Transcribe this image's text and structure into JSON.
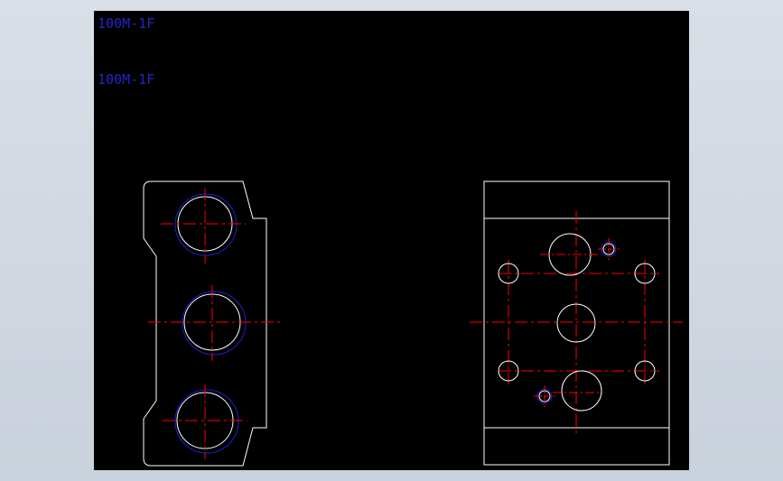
{
  "drawing": {
    "labels": [
      "100M-1F",
      "100M-1F"
    ]
  },
  "colors": {
    "background": "#000000",
    "outline": "#ffffff",
    "centerline": "#ff0000",
    "hidden_circle": "#1f1fd0",
    "text": "#2626c4"
  }
}
